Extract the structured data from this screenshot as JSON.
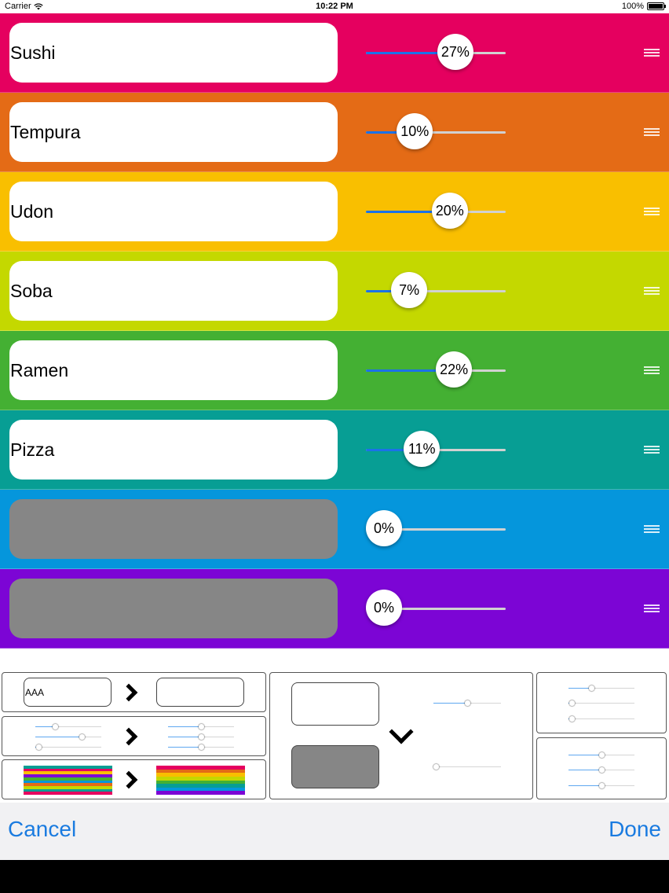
{
  "status_bar": {
    "carrier": "Carrier",
    "time": "10:22 PM",
    "battery": "100%"
  },
  "rows": [
    {
      "name": "Sushi",
      "percent": "27%",
      "value": 0.27,
      "color": "#e5005f",
      "fill": 0.64,
      "empty": false
    },
    {
      "name": "Tempura",
      "percent": "10%",
      "value": 0.1,
      "color": "#e46b16",
      "fill": 0.35,
      "empty": false
    },
    {
      "name": "Udon",
      "percent": "20%",
      "value": 0.2,
      "color": "#f9bf00",
      "fill": 0.6,
      "empty": false
    },
    {
      "name": "Soba",
      "percent": "7%",
      "value": 0.07,
      "color": "#c4d800",
      "fill": 0.31,
      "empty": false
    },
    {
      "name": "Ramen",
      "percent": "22%",
      "value": 0.22,
      "color": "#44b033",
      "fill": 0.63,
      "empty": false
    },
    {
      "name": "Pizza",
      "percent": "11%",
      "value": 0.11,
      "color": "#079e94",
      "fill": 0.4,
      "empty": false
    },
    {
      "name": "",
      "percent": "0%",
      "value": 0.0,
      "color": "#0596dc",
      "fill": 0.0,
      "empty": true
    },
    {
      "name": "",
      "percent": "0%",
      "value": 0.0,
      "color": "#7c05d5",
      "fill": 0.0,
      "empty": true
    }
  ],
  "modes": {
    "sample_text": "AAA"
  },
  "stripe_colors": [
    "#e5005f",
    "#e46b16",
    "#f9bf00",
    "#c4d800",
    "#44b033",
    "#079e94",
    "#0596dc",
    "#7c05d5"
  ],
  "toolbar": {
    "cancel_label": "Cancel",
    "done_label": "Done"
  },
  "colors": {
    "accent": "#1a7be0",
    "slider_fill": "#1b72e8"
  }
}
